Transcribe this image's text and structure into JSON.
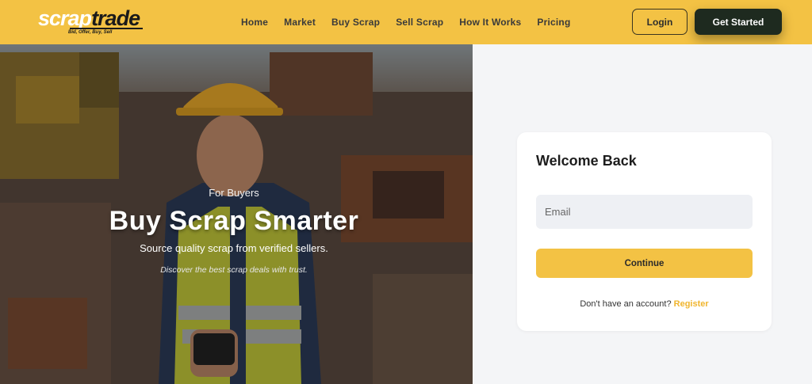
{
  "brand": {
    "name_part1": "scrap",
    "name_part2": "trade",
    "tagline": "Bid, Offer, Buy, Sell"
  },
  "nav": {
    "links": [
      "Home",
      "Market",
      "Buy Scrap",
      "Sell Scrap",
      "How It Works",
      "Pricing"
    ],
    "login_label": "Login",
    "get_started_label": "Get Started"
  },
  "hero": {
    "eyebrow": "For Buyers",
    "title": "Buy Scrap Smarter",
    "subtitle": "Source quality scrap from verified sellers.",
    "note": "Discover the best scrap deals with trust."
  },
  "login_card": {
    "title": "Welcome Back",
    "email_placeholder": "Email",
    "email_value": "",
    "continue_label": "Continue",
    "no_account_text": "Don't have an account?",
    "register_label": "Register"
  },
  "colors": {
    "accent": "#f3c244",
    "dark_button": "#1e2a1f",
    "register_link": "#f0b52e",
    "page_bg": "#f4f5f7"
  }
}
